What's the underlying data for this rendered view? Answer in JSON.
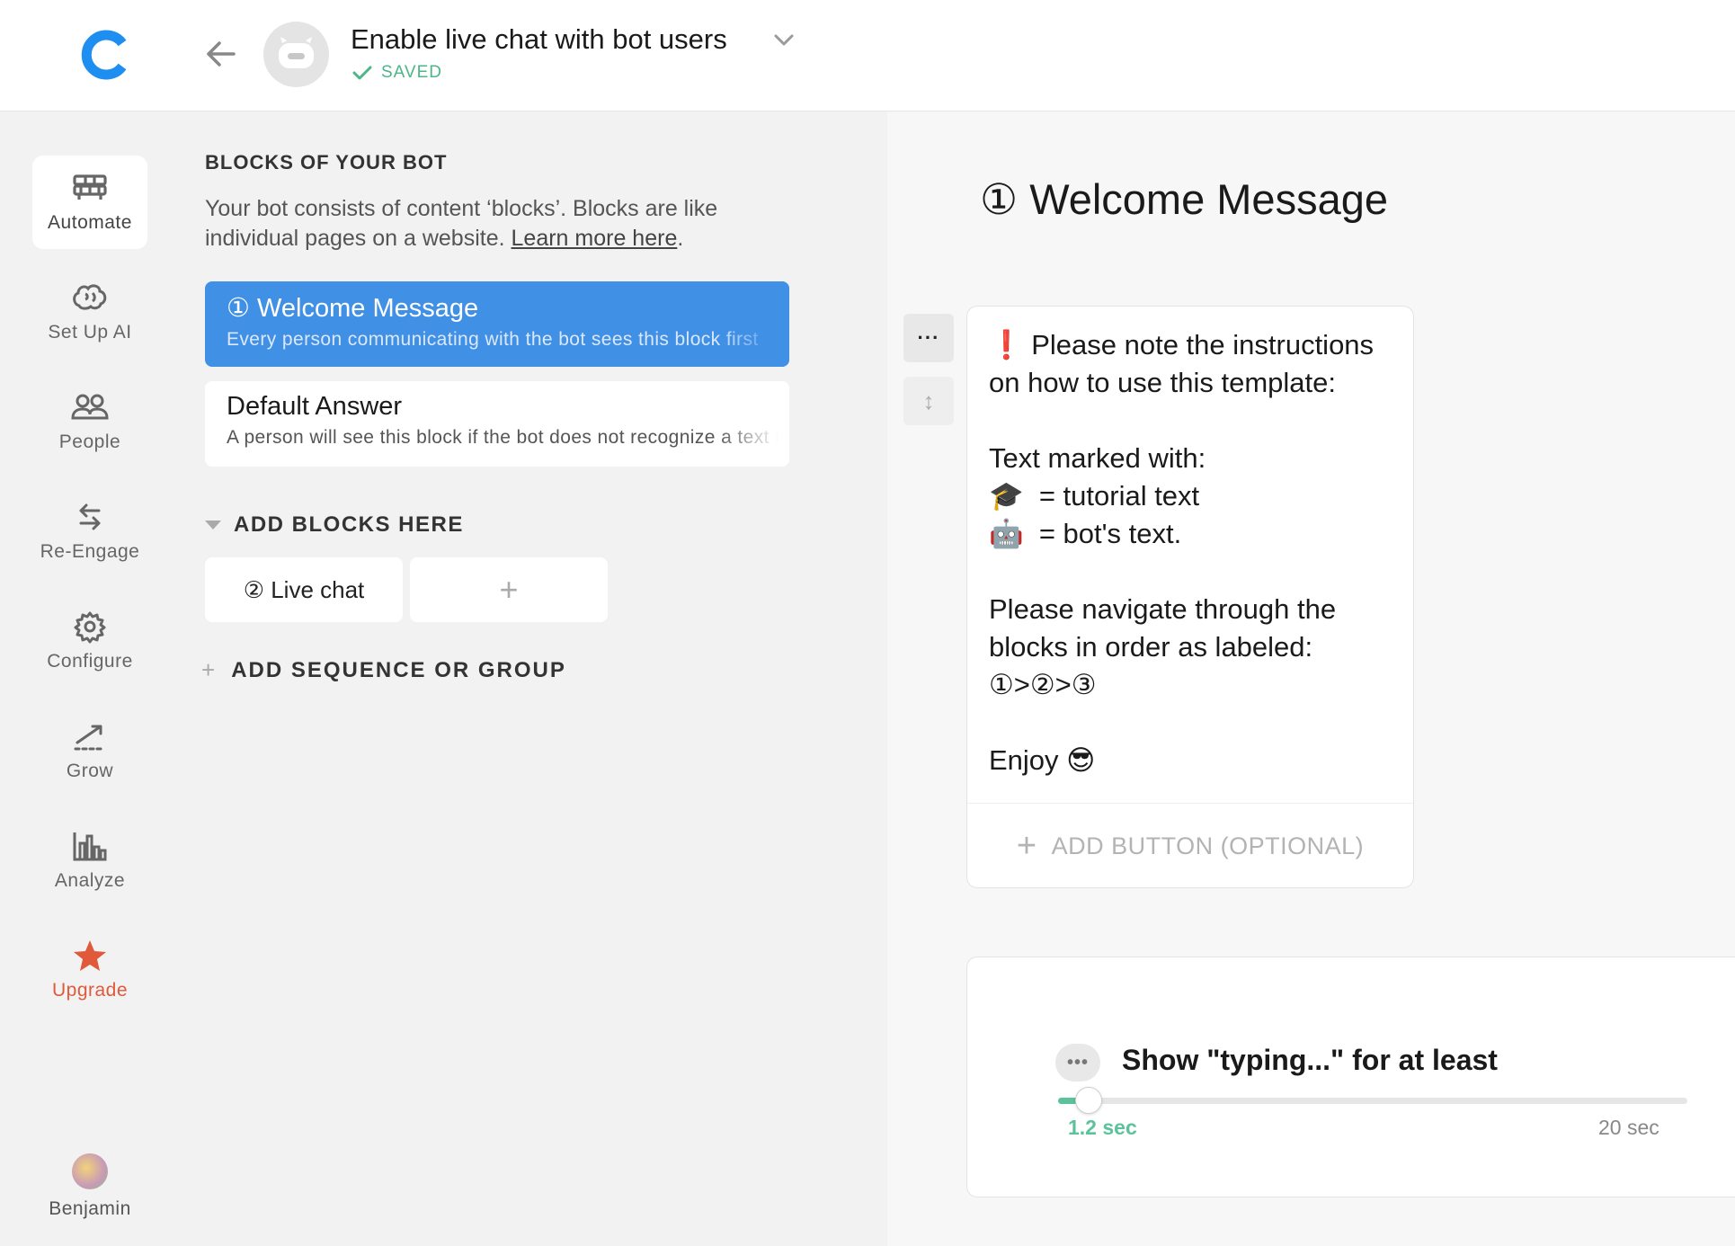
{
  "header": {
    "title": "Enable live chat with bot users",
    "status": "SAVED",
    "logo_icon": "chatfuel-logo-icon",
    "back_icon": "arrow-left-icon",
    "avatar_icon": "robot-icon",
    "chevron_icon": "chevron-down-icon"
  },
  "sidebar": {
    "items": [
      {
        "label": "Automate",
        "icon": "blocks-icon",
        "active": true
      },
      {
        "label": "Set Up AI",
        "icon": "brain-icon"
      },
      {
        "label": "People",
        "icon": "people-icon"
      },
      {
        "label": "Re-Engage",
        "icon": "swap-arrows-icon"
      },
      {
        "label": "Configure",
        "icon": "gear-icon"
      },
      {
        "label": "Grow",
        "icon": "growth-arrow-icon"
      },
      {
        "label": "Analyze",
        "icon": "bar-chart-icon"
      },
      {
        "label": "Upgrade",
        "icon": "star-icon",
        "color": "#e0593b"
      }
    ],
    "user": {
      "name": "Benjamin"
    }
  },
  "middle": {
    "section_title": "BLOCKS OF YOUR BOT",
    "description": "Your bot consists of content ‘blocks’. Blocks are like individual pages on a website.",
    "learn_more": "Learn more here",
    "description_end": ".",
    "blocks": [
      {
        "title": "① Welcome Message",
        "subtitle": "Every person communicating with the bot sees this block first",
        "selected": true
      },
      {
        "title": "Default Answer",
        "subtitle": "A person will see this block if the bot does not recognize a text message",
        "selected": false
      }
    ],
    "add_blocks_title": "ADD BLOCKS HERE",
    "add_blocks_items": [
      {
        "label": "② Live chat"
      },
      {
        "label": "+"
      }
    ],
    "add_sequence": "ADD SEQUENCE OR GROUP",
    "add_sequence_plus": "+"
  },
  "editor": {
    "heading": "① Welcome Message",
    "more_button": "···",
    "reorder_button": "↕",
    "message_text": "❗ Please note the instructions on how to use this template:\n\nText marked with:\n🎓  = tutorial text\n🤖  = bot's text.\n\nPlease navigate through the blocks in order as labeled: ①>②>③\n\nEnjoy 😎",
    "add_button_plus": "+",
    "add_button_label": "ADD BUTTON (OPTIONAL)",
    "typing": {
      "dots": "•••",
      "label": "Show \"typing...\" for at least",
      "value": 1.2,
      "min_label": "1.2 sec",
      "max_label": "20 sec",
      "max": 20
    }
  },
  "colors": {
    "accent_blue": "#4090e6",
    "saved_green": "#4cb58a",
    "slider_green": "#5cc29b",
    "upgrade_red": "#e0593b",
    "logo_blue": "#1e8ff0"
  }
}
